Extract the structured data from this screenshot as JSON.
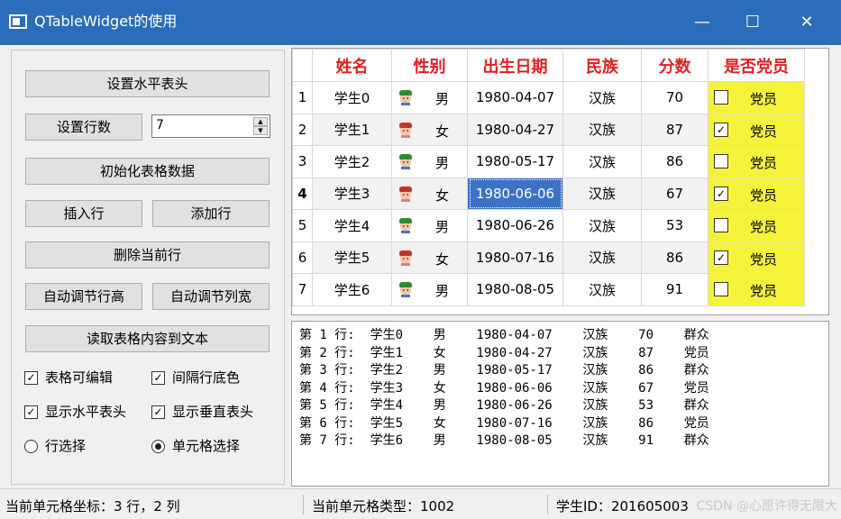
{
  "window": {
    "title": "QTableWidget的使用",
    "min_glyph": "—",
    "max_glyph": "☐",
    "close_glyph": "✕"
  },
  "buttons": {
    "set_header": "设置水平表头",
    "set_rows": "设置行数",
    "init_data": "初始化表格数据",
    "insert_row": "插入行",
    "append_row": "添加行",
    "delete_row": "删除当前行",
    "auto_row_height": "自动调节行高",
    "auto_col_width": "自动调节列宽",
    "read_to_text": "读取表格内容到文本"
  },
  "row_count": {
    "value": "7",
    "up": "▲",
    "down": "▼"
  },
  "options": {
    "editable": {
      "label": "表格可编辑",
      "checked": true
    },
    "alt_rows": {
      "label": "间隔行底色",
      "checked": true
    },
    "show_hheader": {
      "label": "显示水平表头",
      "checked": true
    },
    "show_vheader": {
      "label": "显示垂直表头",
      "checked": true
    },
    "row_select": {
      "label": "行选择",
      "selected": false
    },
    "cell_select": {
      "label": "单元格选择",
      "selected": true
    }
  },
  "table": {
    "headers": [
      "姓名",
      "性别",
      "出生日期",
      "民族",
      "分数",
      "是否党员"
    ],
    "party_label": "党员",
    "rows": [
      {
        "num": "1",
        "name": "学生0",
        "gender": "男",
        "date": "1980-04-07",
        "nation": "汉族",
        "score": "70",
        "party": false
      },
      {
        "num": "2",
        "name": "学生1",
        "gender": "女",
        "date": "1980-04-27",
        "nation": "汉族",
        "score": "87",
        "party": true
      },
      {
        "num": "3",
        "name": "学生2",
        "gender": "男",
        "date": "1980-05-17",
        "nation": "汉族",
        "score": "86",
        "party": false
      },
      {
        "num": "4",
        "name": "学生3",
        "gender": "女",
        "date": "1980-06-06",
        "nation": "汉族",
        "score": "67",
        "party": true
      },
      {
        "num": "5",
        "name": "学生4",
        "gender": "男",
        "date": "1980-06-26",
        "nation": "汉族",
        "score": "53",
        "party": false
      },
      {
        "num": "6",
        "name": "学生5",
        "gender": "女",
        "date": "1980-07-16",
        "nation": "汉族",
        "score": "86",
        "party": true
      },
      {
        "num": "7",
        "name": "学生6",
        "gender": "男",
        "date": "1980-08-05",
        "nation": "汉族",
        "score": "91",
        "party": false
      }
    ]
  },
  "text_output": [
    "第 1 行:  学生0    男    1980-04-07    汉族    70    群众",
    "第 2 行:  学生1    女    1980-04-27    汉族    87    党员",
    "第 3 行:  学生2    男    1980-05-17    汉族    86    群众",
    "第 4 行:  学生3    女    1980-06-06    汉族    67    党员",
    "第 5 行:  学生4    男    1980-06-26    汉族    53    群众",
    "第 6 行:  学生5    女    1980-07-16    汉族    86    党员",
    "第 7 行:  学生6    男    1980-08-05    汉族    91    群众"
  ],
  "status": {
    "coord": "当前单元格坐标：3 行，2 列",
    "type": "当前单元格类型：1002",
    "student_id": "学生ID：201605003"
  },
  "watermark": "CSDN @心愿许得无限大",
  "colors": {
    "titlebar": "#2b6dba",
    "header_text": "#e02020",
    "party_bg": "#f5f23a",
    "selection": "#3d72c9"
  }
}
